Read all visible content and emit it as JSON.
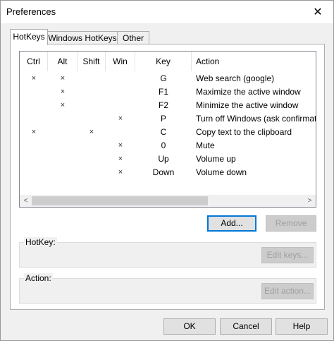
{
  "window": {
    "title": "Preferences",
    "close_glyph": "✕"
  },
  "tabs": [
    {
      "label": "HotKeys",
      "active": true
    },
    {
      "label": "Windows HotKeys",
      "active": false
    },
    {
      "label": "Other",
      "active": false
    }
  ],
  "list": {
    "columns": [
      "Ctrl",
      "Alt",
      "Shift",
      "Win",
      "Key",
      "Action"
    ],
    "rows": [
      {
        "ctrl": "×",
        "alt": "×",
        "shift": "",
        "win": "",
        "key": "G",
        "action": "Web search (google)"
      },
      {
        "ctrl": "",
        "alt": "×",
        "shift": "",
        "win": "",
        "key": "F1",
        "action": "Maximize the active window"
      },
      {
        "ctrl": "",
        "alt": "×",
        "shift": "",
        "win": "",
        "key": "F2",
        "action": "Minimize the active window"
      },
      {
        "ctrl": "",
        "alt": "",
        "shift": "",
        "win": "×",
        "key": "P",
        "action": "Turn off Windows (ask confirmat"
      },
      {
        "ctrl": "×",
        "alt": "",
        "shift": "×",
        "win": "",
        "key": "C",
        "action": "Copy text to the clipboard"
      },
      {
        "ctrl": "",
        "alt": "",
        "shift": "",
        "win": "×",
        "key": "0",
        "action": "Mute"
      },
      {
        "ctrl": "",
        "alt": "",
        "shift": "",
        "win": "×",
        "key": "Up",
        "action": "Volume up"
      },
      {
        "ctrl": "",
        "alt": "",
        "shift": "",
        "win": "×",
        "key": "Down",
        "action": "Volume down"
      }
    ],
    "scroll_left_glyph": "<",
    "scroll_right_glyph": ">"
  },
  "buttons": {
    "add": "Add...",
    "remove": "Remove",
    "edit_keys": "Edit keys...",
    "edit_action": "Edit action...",
    "ok": "OK",
    "cancel": "Cancel",
    "help": "Help"
  },
  "groups": {
    "hotkey": "HotKey:",
    "action": "Action:"
  }
}
